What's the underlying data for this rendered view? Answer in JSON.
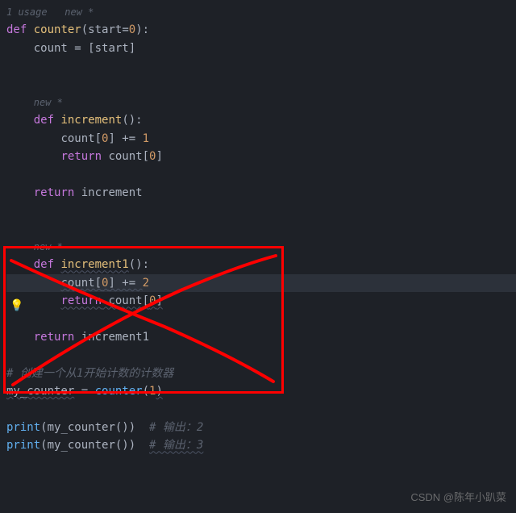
{
  "hints": {
    "usage": "1 usage   new *",
    "new1": "new *",
    "new2": "new *"
  },
  "code": {
    "def1_kw": "def",
    "def1_name": "counter",
    "def1_params": "(start=",
    "def1_default": "0",
    "def1_close": "):",
    "line2_ident": "count",
    "line2_op": " = [start]",
    "def2_kw": "def",
    "def2_name": "increment",
    "def2_close": "():",
    "line5a": "count[",
    "line5b": "0",
    "line5c": "] += ",
    "line5d": "1",
    "ret1_kw": "return",
    "ret1_expr": " count[",
    "ret1_idx": "0",
    "ret1_close": "]",
    "ret2_kw": "return",
    "ret2_expr": " increment",
    "def3_kw": "def",
    "def3_name": "increment1",
    "def3_close": "():",
    "line9a": "count[",
    "line9b": "0",
    "line9c": "] += ",
    "line9d": "2",
    "ret3_kw": "return",
    "ret3_expr": " count[",
    "ret3_idx": "0",
    "ret3_close": "]",
    "ret4_kw": "return",
    "ret4_expr": " increment1",
    "comment1": "# 创建一个从1开始计数的计数器",
    "assign_lhs": "my_counter",
    "assign_op": " = ",
    "assign_fn": "counter",
    "assign_arg_open": "(",
    "assign_arg": "1",
    "assign_arg_close": ")",
    "print_fn": "print",
    "print_arg": "(my_counter())",
    "comment2": "# 输出：2",
    "comment3": "# 输出：3"
  },
  "watermark": "CSDN @陈年小趴菜",
  "bulb": "💡"
}
